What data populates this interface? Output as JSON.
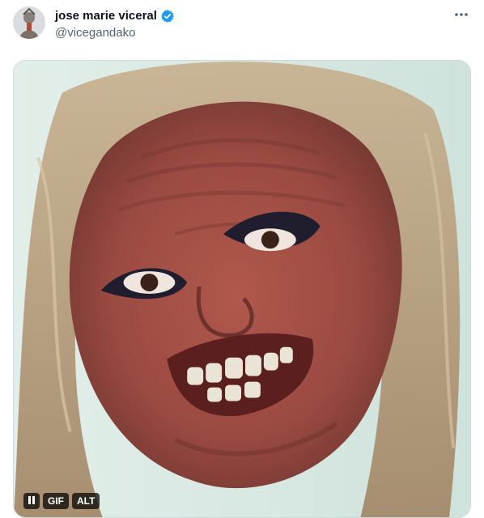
{
  "tweet": {
    "author": {
      "display_name": "jose marie viceral",
      "handle": "@vicegandako",
      "verified": true,
      "verified_color": "#1d9bf0"
    },
    "more_icon": "more-horizontal-icon",
    "media": {
      "type": "gif",
      "controls": {
        "pause_icon": "pause-icon",
        "gif_label": "GIF",
        "alt_label": "ALT"
      }
    }
  }
}
